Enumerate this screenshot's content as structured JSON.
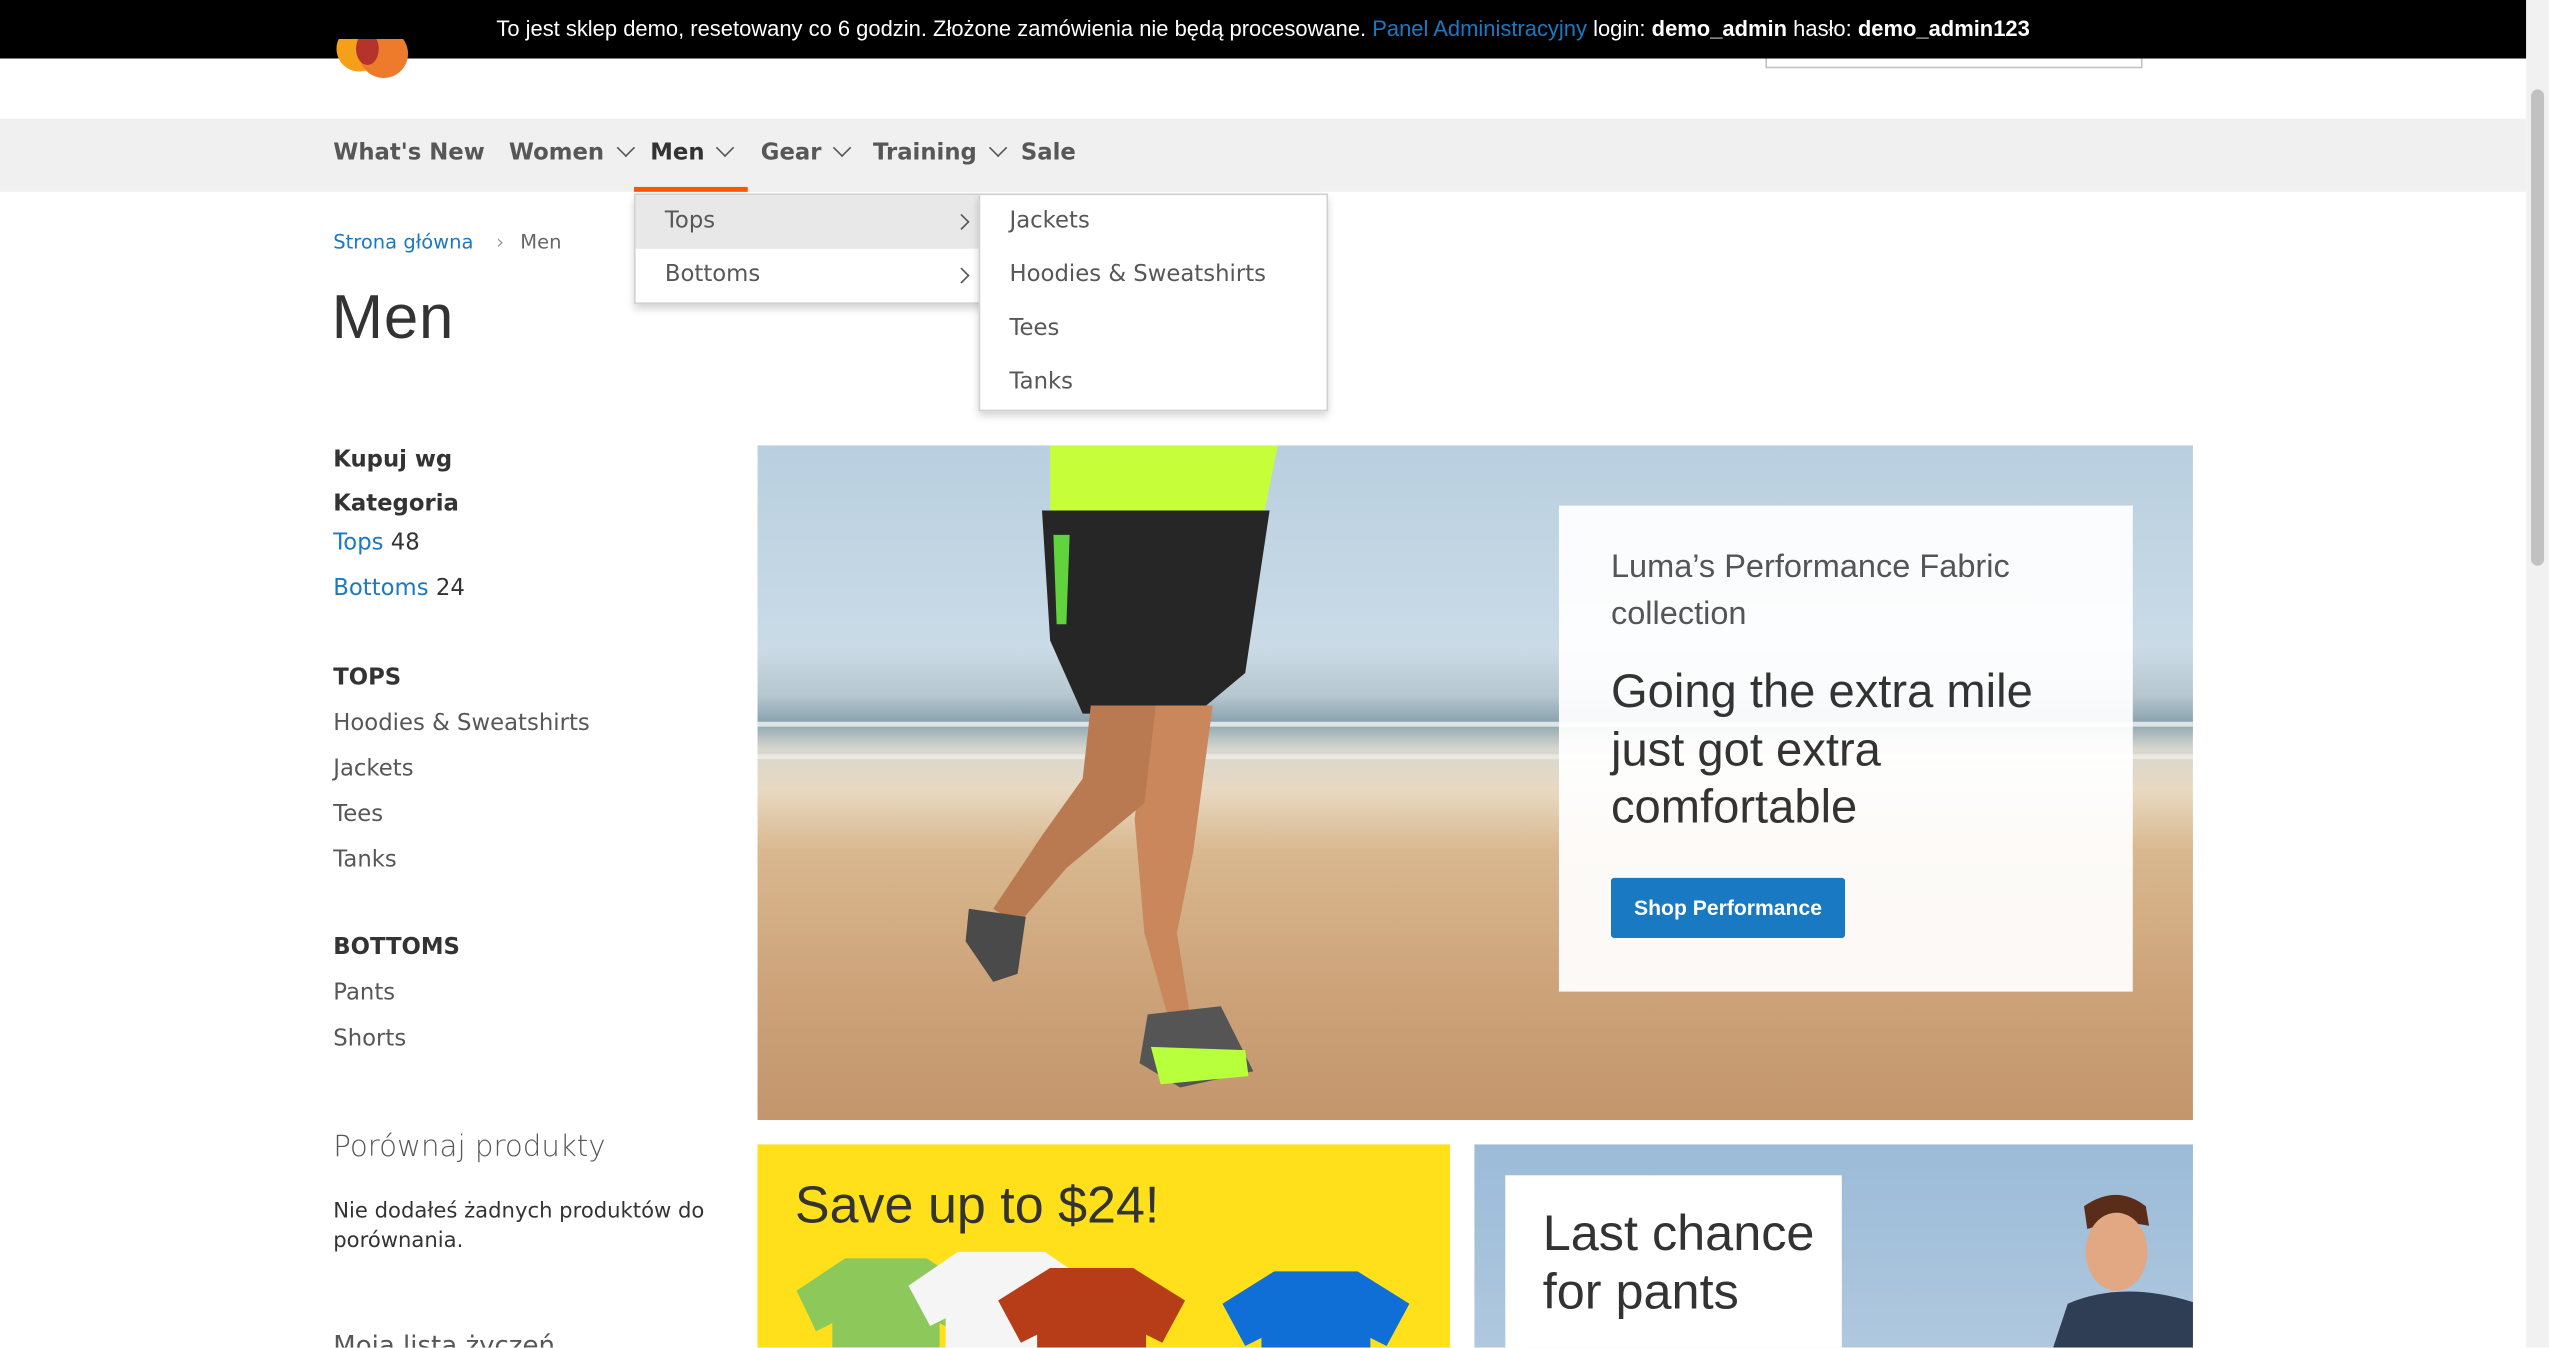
{
  "notice": {
    "text": "To jest sklep demo, resetowany co 6 godzin. Złożone zamówienia nie będą procesowane.",
    "admin_link": "Panel Administracyjny",
    "login_label": "login:",
    "login_value": "demo_admin",
    "password_label": "hasło:",
    "password_value": "demo_admin123"
  },
  "nav": {
    "items": [
      {
        "label": "What's New"
      },
      {
        "label": "Women"
      },
      {
        "label": "Men"
      },
      {
        "label": "Gear"
      },
      {
        "label": "Training"
      },
      {
        "label": "Sale"
      }
    ]
  },
  "menu": {
    "level1": [
      {
        "label": "Tops"
      },
      {
        "label": "Bottoms"
      }
    ],
    "level2": [
      {
        "label": "Jackets"
      },
      {
        "label": "Hoodies & Sweatshirts"
      },
      {
        "label": "Tees"
      },
      {
        "label": "Tanks"
      }
    ]
  },
  "breadcrumb": {
    "home": "Strona główna",
    "current": "Men"
  },
  "page_title": "Men",
  "sidebar": {
    "shop_by": "Kupuj wg",
    "category_title": "Kategoria",
    "categories": [
      {
        "label": "Tops",
        "count": "48"
      },
      {
        "label": "Bottoms",
        "count": "24"
      }
    ],
    "tops_title": "TOPS",
    "tops": [
      "Hoodies & Sweatshirts",
      "Jackets",
      "Tees",
      "Tanks"
    ],
    "bottoms_title": "BOTTOMS",
    "bottoms": [
      "Pants",
      "Shorts"
    ],
    "compare_title": "Porównaj produkty",
    "compare_empty": "Nie dodałeś żadnych produktów do porównania.",
    "wishlist_title": "Moja lista życzeń"
  },
  "hero": {
    "subtitle": "Luma’s Performance Fabric collection",
    "headline": "Going the extra mile just got extra comfortable",
    "button": "Shop Performance"
  },
  "promo_yellow": {
    "title": "Save up to $24!"
  },
  "promo_blue": {
    "title": "Last chance for pants"
  },
  "colors": {
    "accent": "#1979c3",
    "nav_active": "#ff5501",
    "yellow": "#ffe01b"
  }
}
